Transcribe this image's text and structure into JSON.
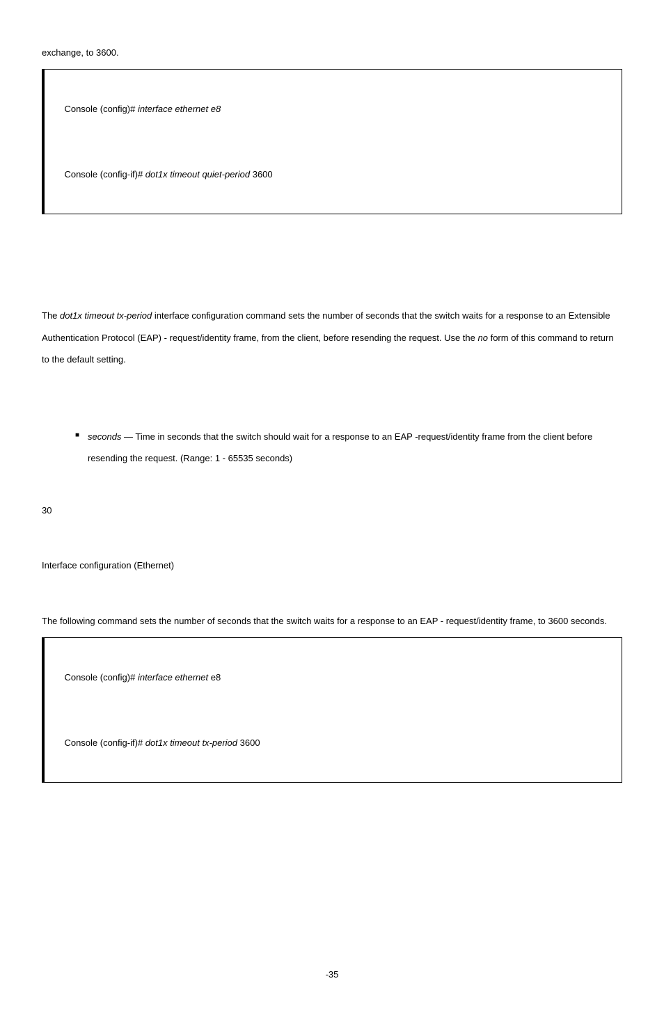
{
  "intro_line": "exchange, to 3600.",
  "code1": {
    "line1_prefix": "Console (config)#",
    "line1_rest": " interface ethernet e8",
    "line2_prefix": "Console (config-if)#",
    "line2_mid": " dot1x timeout quiet-period ",
    "line2_num": "3600"
  },
  "desc": {
    "p1a": "The ",
    "p1b": "dot1x timeout tx-period",
    "p1c": " interface configuration command sets the number of seconds that the switch waits for a response to an Extensible Authentication Protocol (EAP) - request/identity frame, from the client, before resending the request. Use the ",
    "p1d": "no",
    "p1e": " form of this command to return to the default setting."
  },
  "bullet": {
    "label": "seconds —",
    "text": " Time in seconds that the switch should wait for a response to an EAP -request/identity frame from the client before resending the request. (Range: 1 - 65535 seconds)"
  },
  "thirty": "30",
  "iface": "Interface configuration (Ethernet)",
  "example_intro": "The following command sets the number of seconds that the switch waits for a response to an EAP - request/identity frame, to 3600 seconds.",
  "code2": {
    "line1_prefix": "Console (config)#",
    "line1_mid": " interface ethernet ",
    "line1_arg": "e8",
    "line2_prefix": "Console (config-if)#",
    "line2_mid": " dot1x timeout tx-period ",
    "line2_num": "3600"
  },
  "pagenum": "-35"
}
